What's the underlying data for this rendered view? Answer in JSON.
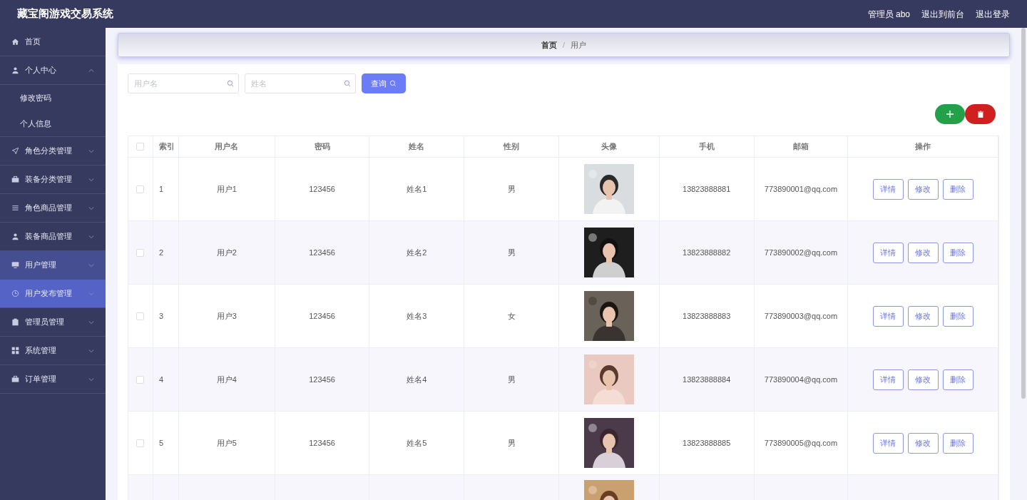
{
  "header": {
    "title": "藏宝阁游戏交易系统",
    "user": "管理员 abo",
    "links": [
      "退出到前台",
      "退出登录"
    ]
  },
  "sidebar": {
    "items": [
      {
        "label": "首页",
        "selected": false,
        "hovered": false
      },
      {
        "label": "个人中心",
        "selected": false,
        "hovered": false,
        "expanded": true,
        "children": [
          {
            "label": "修改密码"
          },
          {
            "label": "个人信息"
          }
        ]
      },
      {
        "label": "角色分类管理",
        "selected": false,
        "hovered": false,
        "expanded": false
      },
      {
        "label": "装备分类管理",
        "selected": false,
        "hovered": false,
        "expanded": false
      },
      {
        "label": "角色商品管理",
        "selected": false,
        "hovered": false,
        "expanded": false
      },
      {
        "label": "装备商品管理",
        "selected": false,
        "hovered": false,
        "expanded": false
      },
      {
        "label": "用户管理",
        "selected": true,
        "hovered": false,
        "expanded": false
      },
      {
        "label": "用户发布管理",
        "selected": false,
        "hovered": true,
        "expanded": false
      },
      {
        "label": "管理员管理",
        "selected": false,
        "hovered": false,
        "expanded": false
      },
      {
        "label": "系统管理",
        "selected": false,
        "hovered": false,
        "expanded": false
      },
      {
        "label": "订单管理",
        "selected": false,
        "hovered": false,
        "expanded": false
      }
    ]
  },
  "breadcrumb": {
    "items": [
      "首页",
      "用户"
    ],
    "separator": "/"
  },
  "search": {
    "fields": [
      {
        "placeholder": "用户名"
      },
      {
        "placeholder": "姓名"
      }
    ],
    "button": "查询"
  },
  "table": {
    "select_all": {
      "checked": false
    },
    "columns": [
      "索引",
      "用户名",
      "密码",
      "姓名",
      "性别",
      "头像",
      "手机",
      "邮箱",
      "操作"
    ],
    "rows": [
      {
        "checked": false,
        "cells": [
          "1",
          "用户1",
          "123456",
          "姓名1",
          "男",
          "",
          "13823888881",
          "773890001@qq.com"
        ],
        "actions": [
          "详情",
          "修改",
          "删除"
        ]
      },
      {
        "checked": false,
        "cells": [
          "2",
          "用户2",
          "123456",
          "姓名2",
          "男",
          "",
          "13823888882",
          "773890002@qq.com"
        ],
        "actions": [
          "详情",
          "修改",
          "删除"
        ]
      },
      {
        "checked": false,
        "cells": [
          "3",
          "用户3",
          "123456",
          "姓名3",
          "女",
          "",
          "13823888883",
          "773890003@qq.com"
        ],
        "actions": [
          "详情",
          "修改",
          "删除"
        ]
      },
      {
        "checked": false,
        "cells": [
          "4",
          "用户4",
          "123456",
          "姓名4",
          "男",
          "",
          "13823888884",
          "773890004@qq.com"
        ],
        "actions": [
          "详情",
          "修改",
          "删除"
        ]
      },
      {
        "checked": false,
        "cells": [
          "5",
          "用户5",
          "123456",
          "姓名5",
          "男",
          "",
          "13823888885",
          "773890005@qq.com"
        ],
        "actions": [
          "详情",
          "修改",
          "删除"
        ]
      }
    ]
  }
}
